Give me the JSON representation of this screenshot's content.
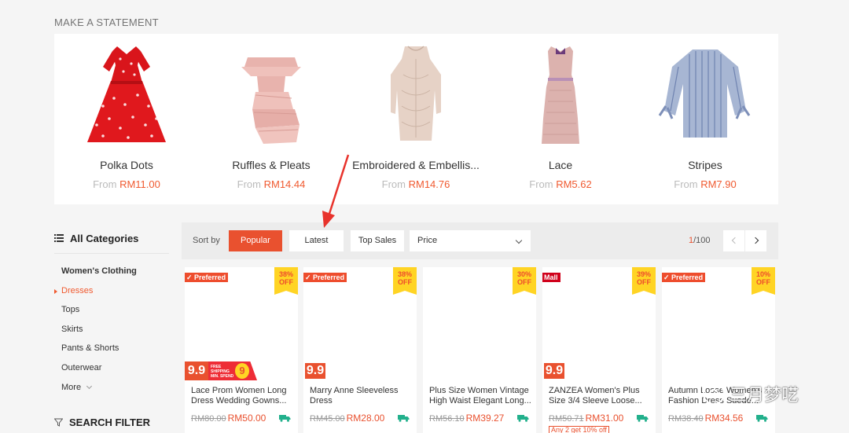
{
  "section": {
    "title": "MAKE A STATEMENT"
  },
  "categories": [
    {
      "name": "Polka Dots",
      "from": "From",
      "price": "RM11.00"
    },
    {
      "name": "Ruffles & Pleats",
      "from": "From",
      "price": "RM14.44"
    },
    {
      "name": "Embroidered & Embellis...",
      "from": "From",
      "price": "RM14.76"
    },
    {
      "name": "Lace",
      "from": "From",
      "price": "RM5.62"
    },
    {
      "name": "Stripes",
      "from": "From",
      "price": "RM7.90"
    }
  ],
  "sidebar": {
    "heading": "All Categories",
    "items": [
      {
        "label": "Women's Clothing"
      },
      {
        "label": "Dresses"
      },
      {
        "label": "Tops"
      },
      {
        "label": "Skirts"
      },
      {
        "label": "Pants & Shorts"
      },
      {
        "label": "Outerwear"
      },
      {
        "label": "More"
      }
    ],
    "filter_heading": "SEARCH FILTER"
  },
  "sortbar": {
    "label": "Sort by",
    "buttons": [
      {
        "label": "Popular"
      },
      {
        "label": "Latest"
      },
      {
        "label": "Top Sales"
      }
    ],
    "price_select": "Price",
    "page_current": "1",
    "page_total": "/100"
  },
  "products": [
    {
      "badge": "✓ Preferred",
      "off_pct": "38%",
      "off_label": "OFF",
      "nn": "9.9",
      "ship_text": "FREE SHIPPING MIN. SPEND",
      "ship_num": "9",
      "title": "Lace Prom Women Long Dress Wedding Gowns...",
      "old_price": "RM80.00",
      "price": "RM50.00"
    },
    {
      "badge": "✓ Preferred",
      "off_pct": "38%",
      "off_label": "OFF",
      "nn": "9.9",
      "title": "Marry Anne Sleeveless Dress",
      "old_price": "RM45.00",
      "price": "RM28.00"
    },
    {
      "off_pct": "30%",
      "off_label": "OFF",
      "title": "Plus Size Women Vintage High Waist Elegant Long...",
      "old_price": "RM56.10",
      "price": "RM39.27"
    },
    {
      "badge": "Mall",
      "off_pct": "39%",
      "off_label": "OFF",
      "nn": "9.9",
      "title": "ZANZEA Women's Plus Size 3/4 Sleeve Loose...",
      "old_price": "RM50.71",
      "price": "RM31.00",
      "promo": "Any 2 get 10% off"
    },
    {
      "badge": "✓ Preferred",
      "off_pct": "10%",
      "off_label": "OFF",
      "title": "Autumn Loose Women's Fashion Dress Suede...",
      "old_price": "RM38.40",
      "price": "RM34.56"
    }
  ],
  "watermark": {
    "text": "三月梦呓"
  },
  "colors": {
    "accent": "#e9512f",
    "badge_yellow": "#ffd424"
  }
}
